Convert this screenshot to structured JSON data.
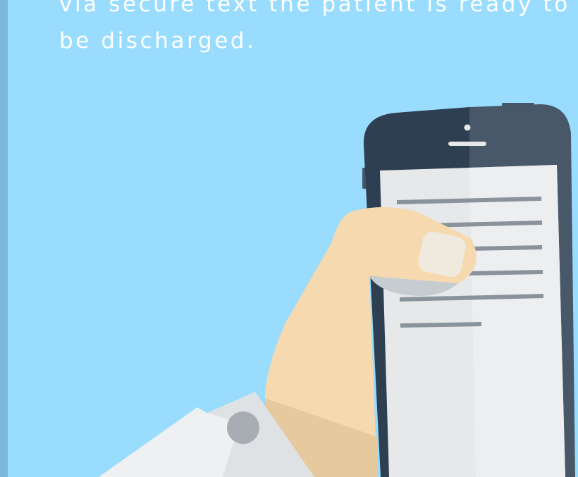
{
  "slide": {
    "caption": "via secure text the patient is ready to be discharged."
  },
  "colors": {
    "background": "#9adcfd",
    "left_edge": "#7bb7d8",
    "phone_body_dark": "#2f3f52",
    "phone_body_light": "#485868",
    "screen": "#e6e8ea",
    "screen_lines": "#8a929c",
    "hand": "#f6d9ae",
    "hand_shadow": "#e7c99e",
    "thumbnail": "#f0e9dd",
    "sleeve": "#eef0f1",
    "sleeve_shadow": "#d9dcdf",
    "button": "#a7adb3"
  },
  "icons": {
    "phone": "smartphone-icon",
    "hand": "hand-icon",
    "message_lines": "text-lines-icon",
    "sleeve": "coat-sleeve-icon"
  }
}
